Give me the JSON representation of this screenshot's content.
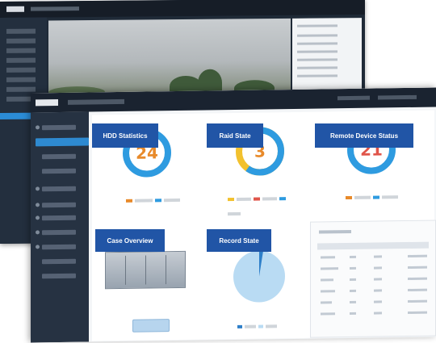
{
  "labels": {
    "hdd_statistics": "HDD Statistics",
    "raid_state": "Raid State",
    "remote_device_status": "Remote Device Status",
    "case_overview": "Case Overview",
    "record_state": "Record State"
  },
  "rings": [
    {
      "name": "hdd",
      "value": "24",
      "fraction": 0.8,
      "color": "#2e9be0",
      "text_color": "#e88a2a"
    },
    {
      "name": "raid",
      "value": "3",
      "fraction": 0.6,
      "color": "#2e9be0",
      "accent": "#f2c12e",
      "text_color": "#e88a2a"
    },
    {
      "name": "remote",
      "value": "21",
      "fraction": 0.92,
      "color": "#2e9be0",
      "text_color": "#e0554a"
    }
  ],
  "colors": {
    "label_bg": "#2155a6",
    "topbar": "#1a2330",
    "sidebar": "#263242",
    "active": "#2e8ad1"
  },
  "icons": {
    "video": "camera-view-icon"
  }
}
